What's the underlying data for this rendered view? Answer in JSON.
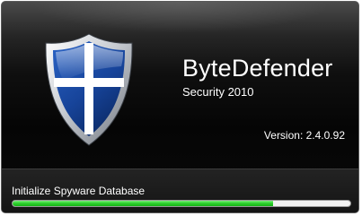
{
  "app": {
    "product_name": "ByteDefender",
    "edition": "Security 2010",
    "version": "Version: 2.4.0.92",
    "logo_icon": "shield-icon"
  },
  "loading": {
    "status_text": "Initialize Spyware Database",
    "progress_fraction": 0.77
  },
  "colors": {
    "background": "#050505",
    "shield_blue": "#1f4fa6",
    "progress_green": "#2fd22f",
    "text": "#ffffff"
  }
}
